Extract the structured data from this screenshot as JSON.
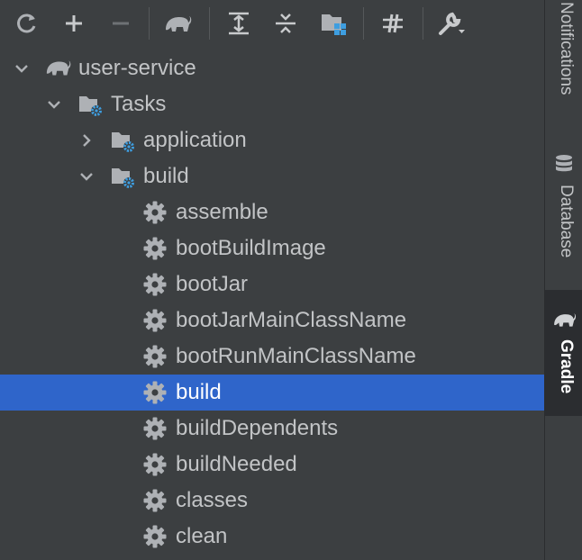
{
  "toolbar": {
    "icons": [
      "refresh-icon",
      "add-icon",
      "remove-icon",
      "gradle-elephant-icon",
      "expand-all-icon",
      "collapse-all-icon",
      "group-modules-icon",
      "toggle-offline-icon",
      "settings-wrench-icon"
    ]
  },
  "tree": {
    "project": "user-service",
    "tasks_folder": "Tasks",
    "groups": [
      {
        "label": "application",
        "expanded": false
      },
      {
        "label": "build",
        "expanded": true
      }
    ],
    "build_tasks": [
      "assemble",
      "bootBuildImage",
      "bootJar",
      "bootJarMainClassName",
      "bootRunMainClassName",
      "build",
      "buildDependents",
      "buildNeeded",
      "classes",
      "clean"
    ],
    "selected_task": "build"
  },
  "right_tabs": {
    "notifications": "Notifications",
    "database": "Database",
    "gradle": "Gradle"
  },
  "colors": {
    "background": "#3c3f41",
    "selection": "#2f65ca",
    "accent_blue": "#3e9ee0",
    "icon_gray": "#aeb1b5"
  }
}
